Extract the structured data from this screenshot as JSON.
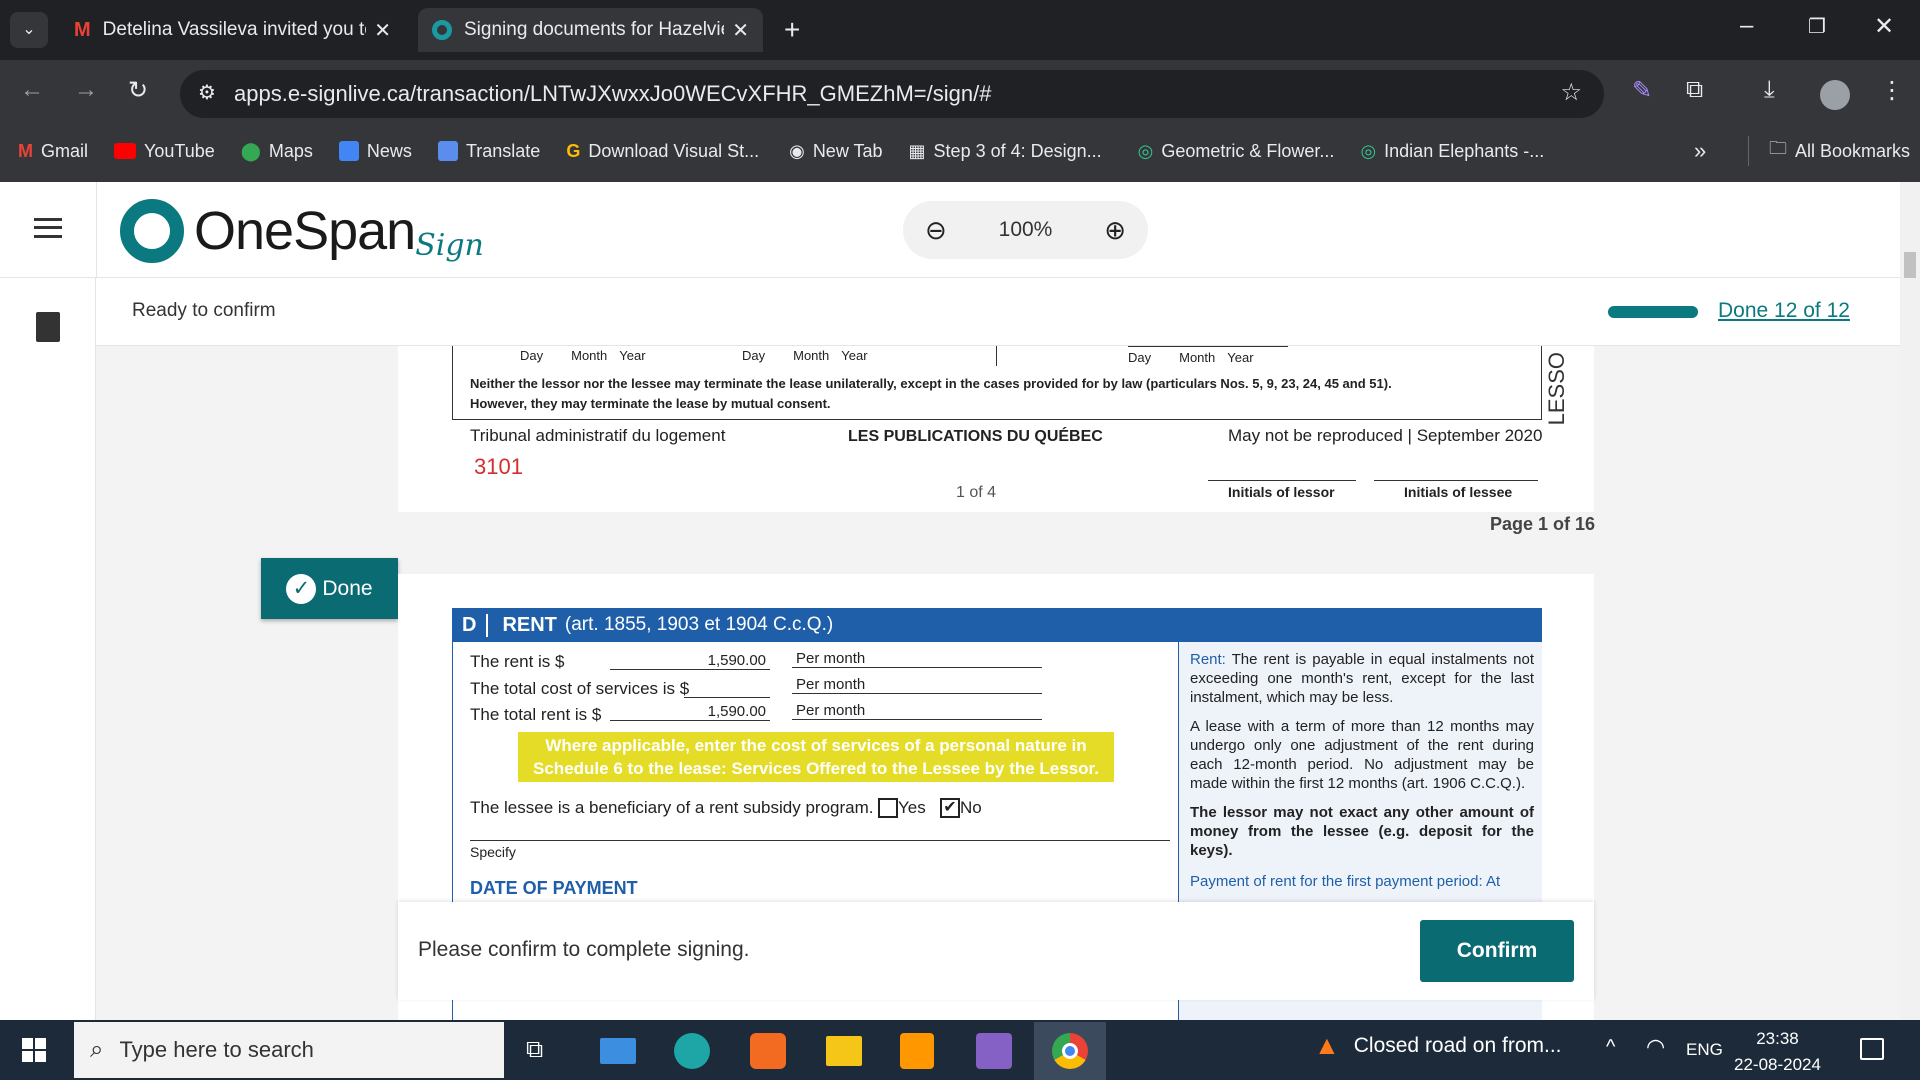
{
  "browser": {
    "tabs": [
      {
        "title": "Detelina Vassileva invited you to",
        "icon": "gmail-icon"
      },
      {
        "title": "Signing documents for Hazelvie",
        "icon": "onespan-icon"
      }
    ],
    "url": "apps.e-signlive.ca/transaction/LNTwJXwxxJo0WECvXFHR_GMEZhM=/sign/#",
    "bookmarks": [
      "Gmail",
      "YouTube",
      "Maps",
      "News",
      "Translate",
      "Download Visual St...",
      "New Tab",
      "Step 3 of 4: Design...",
      "Geometric & Flower...",
      "Indian Elephants -..."
    ],
    "all_bookmarks": "All Bookmarks",
    "overflow": "»"
  },
  "app": {
    "logo_text": "OneSpan",
    "logo_script": "Sign",
    "zoom": "100%",
    "status": "Ready to confirm",
    "progress_label": "Done 12 of 12",
    "progress": 1.0,
    "done_button": "Done",
    "confirm_message": "Please confirm to complete signing.",
    "confirm_button": "Confirm",
    "page_label": "Page 1 of 16"
  },
  "page1": {
    "date_labels_a": [
      "Day",
      "Month",
      "Year"
    ],
    "date_labels_b": [
      "Day",
      "Month",
      "Year"
    ],
    "date_labels_c": [
      "Day",
      "Month",
      "Year"
    ],
    "notice_line1": "Neither the lessor nor the lessee may terminate the lease unilaterally, except in the cases provided for by law (particulars Nos. 5, 9, 23, 24, 45 and 51).",
    "notice_line2": "However, they may terminate the lease by mutual consent.",
    "side_tab": "LESSO",
    "footer_left": "Tribunal administratif du logement",
    "footer_center": "LES PUBLICATIONS DU QUÉBEC",
    "footer_right": "May not be reproduced | September 2020",
    "form_number": "3101",
    "page_of": "1 of 4",
    "initials_lessor": "Initials of lessor",
    "initials_lessee": "Initials of lessee"
  },
  "page2": {
    "section_letter": "D",
    "section_title": "RENT",
    "section_ref": "(art. 1855, 1903 et 1904 C.c.Q.)",
    "rows": [
      {
        "label": "The rent is $",
        "value": "1,590.00",
        "period": "Per month"
      },
      {
        "label": "The total cost of services is $",
        "value": "",
        "period": "Per month"
      },
      {
        "label": "The total rent is $",
        "value": "1,590.00",
        "period": "Per month"
      }
    ],
    "highlight_line1": "Where applicable, enter the cost of services of a personal nature in",
    "highlight_line2": "Schedule 6 to the lease: Services Offered to the Lessee by the Lessor.",
    "subsidy_label": "The lessee is a beneficiary of a rent subsidy program.",
    "yes_label": "Yes",
    "no_label": "No",
    "no_checked": true,
    "specify_label": "Specify",
    "date_of_payment": "DATE OF PAYMENT",
    "side_rent_title": "Rent:",
    "side_rent_text": "The rent is payable in equal instalments not exceeding one month's rent, except for the last instalment, which may be less.",
    "side_adjust_text": "A lease with a term of more than 12 months may undergo only one adjustment of the rent during each 12-month period. No adjustment may be made within the first 12 months (art. 1906 C.C.Q.).",
    "side_exact_text": "The lessor may not exact any other amount of money from the lessee (e.g. deposit for the keys).",
    "side_payment_text": "Payment of rent for the first payment period: At"
  },
  "taskbar": {
    "search_placeholder": "Type here to search",
    "news_text": "Closed road on from...",
    "lang": "ENG",
    "time": "23:38",
    "date": "22-08-2024"
  }
}
